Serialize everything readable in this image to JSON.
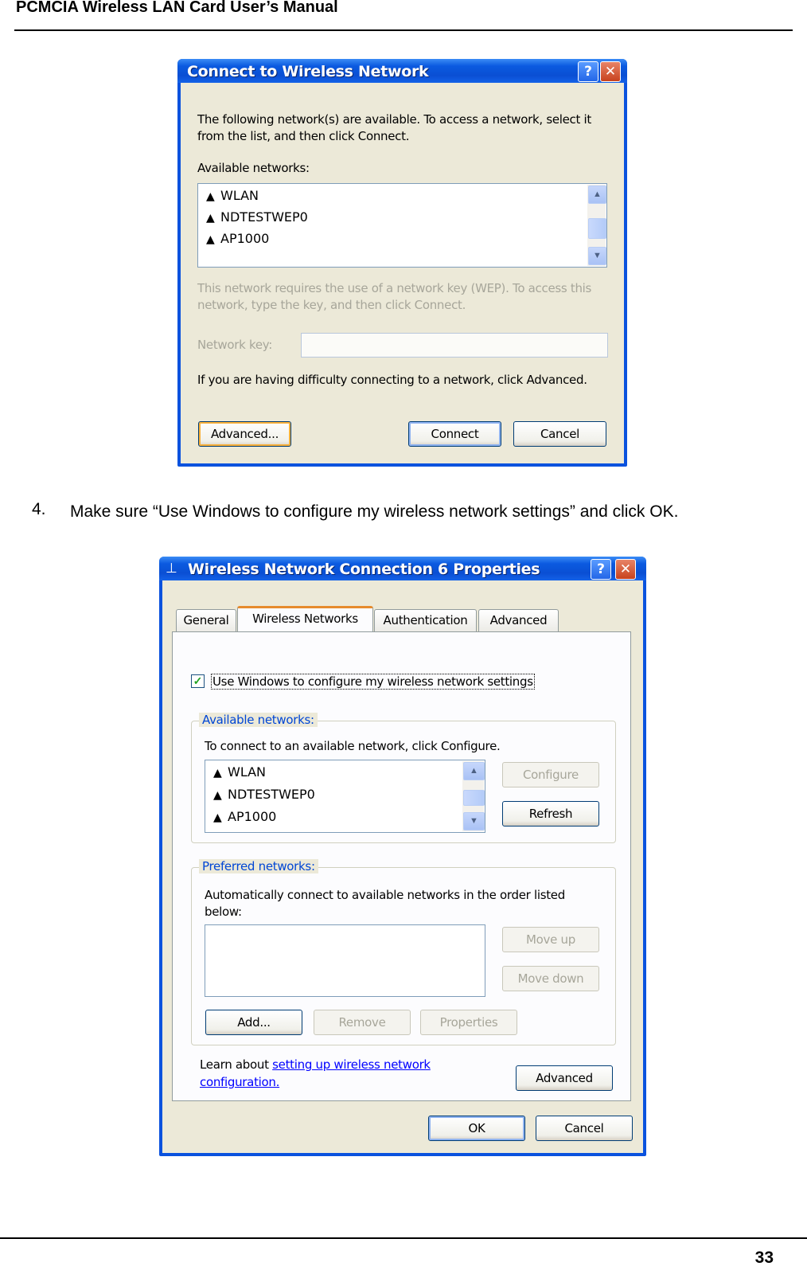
{
  "page": {
    "header_title": "PCMCIA Wireless LAN Card User’s Manual",
    "page_number": "33",
    "step_number": "4.",
    "step_text": "Make sure “Use Windows to configure my wireless network settings” and click OK."
  },
  "connect_dialog": {
    "title": "Connect to Wireless Network",
    "help_glyph": "?",
    "close_glyph": "✕",
    "intro": "The following network(s) are available. To access a network, select it from the list, and then click Connect.",
    "available_label": "Available networks:",
    "networks": [
      "WLAN",
      "NDTESTWEP0",
      "AP1000"
    ],
    "wep_note": "This network requires the use of a network key (WEP). To access this network, type the key, and then click Connect.",
    "network_key_label": "Network key:",
    "network_key_value": "",
    "difficulty_text": "If you are having difficulty connecting to a network, click Advanced.",
    "advanced_button": "Advanced...",
    "connect_button": "Connect",
    "cancel_button": "Cancel"
  },
  "properties_dialog": {
    "title": "Wireless Network Connection 6 Properties",
    "help_glyph": "?",
    "close_glyph": "✕",
    "tabs": [
      "General",
      "Wireless Networks",
      "Authentication",
      "Advanced"
    ],
    "active_tab": "Wireless Networks",
    "use_windows_checkbox": {
      "label": "Use Windows to configure my wireless network settings",
      "checked": true
    },
    "available_group": {
      "title": "Available networks:",
      "instruction": "To connect to an available network, click Configure.",
      "networks": [
        "WLAN",
        "NDTESTWEP0",
        "AP1000"
      ],
      "configure_button": "Configure",
      "refresh_button": "Refresh"
    },
    "preferred_group": {
      "title": "Preferred networks:",
      "instruction": "Automatically connect to available networks in the order listed below:",
      "networks": [],
      "move_up_button": "Move up",
      "move_down_button": "Move down",
      "add_button": "Add...",
      "remove_button": "Remove",
      "properties_button": "Properties"
    },
    "learn_about_text": "Learn about",
    "learn_about_link": "setting up wireless network configuration.",
    "advanced_button": "Advanced",
    "ok_button": "OK",
    "cancel_button": "Cancel"
  },
  "colors": {
    "titlebar_blue": "#0a52de",
    "dialog_face": "#ece9d8",
    "group_title_blue": "#0046d5",
    "link_blue": "#0000ff",
    "active_tab_accent": "#e68b2c"
  },
  "icons": {
    "network": "antenna-icon",
    "checkbox": "checkmark-icon"
  }
}
